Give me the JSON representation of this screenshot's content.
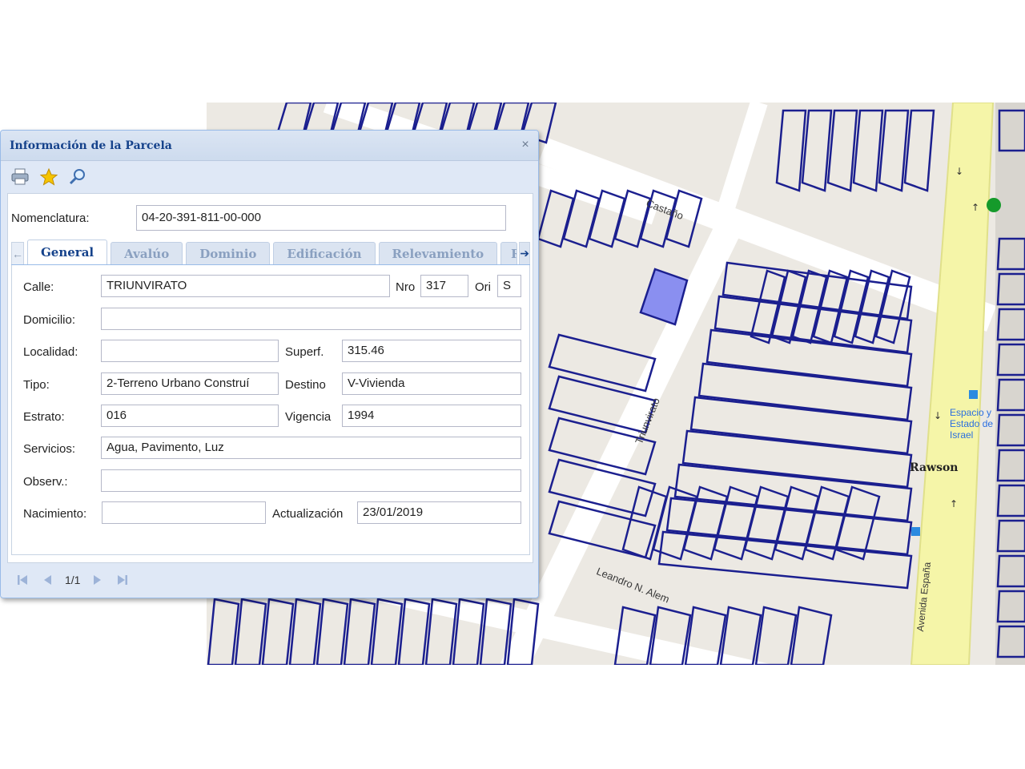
{
  "dialog": {
    "title": "Información de la Parcela",
    "close_glyph": "×",
    "toolbar": [
      {
        "icon": "printer-icon"
      },
      {
        "icon": "star-icon"
      },
      {
        "icon": "magnifier-icon"
      }
    ],
    "nomenclatura": {
      "label": "Nomenclatura:",
      "value": "04-20-391-811-00-000"
    },
    "tabs": [
      {
        "label": "General",
        "active": true
      },
      {
        "label": "Avalúo"
      },
      {
        "label": "Dominio"
      },
      {
        "label": "Edificación"
      },
      {
        "label": "Relevamiento"
      },
      {
        "label": "Ri"
      }
    ],
    "tab_prev_glyph": "←",
    "tab_next_glyph": "➔",
    "fields": {
      "calle": {
        "label": "Calle:",
        "value": "TRIUNVIRATO"
      },
      "nro": {
        "label": "Nro",
        "value": "317"
      },
      "ori": {
        "label": "Ori",
        "value": "S"
      },
      "domicilio": {
        "label": "Domicilio:",
        "value": ""
      },
      "localidad": {
        "label": "Localidad:",
        "value": ""
      },
      "superf": {
        "label": "Superf.",
        "value": "315.46"
      },
      "tipo": {
        "label": "Tipo:",
        "value": "2-Terreno Urbano Construí"
      },
      "destino": {
        "label": "Destino",
        "value": "V-Vivienda"
      },
      "estrato": {
        "label": "Estrato:",
        "value": "016"
      },
      "vigencia": {
        "label": "Vigencia",
        "value": "1994"
      },
      "servicios": {
        "label": "Servicios:",
        "value": "Agua, Pavimento, Luz"
      },
      "observ": {
        "label": "Observ.:",
        "value": ""
      },
      "nacimiento": {
        "label": "Nacimiento:",
        "value": ""
      },
      "actualizacion": {
        "label": "Actualización",
        "value": "23/01/2019"
      }
    },
    "pager": {
      "page_text": "1/1"
    }
  },
  "map": {
    "streets": {
      "castano": "Castaño",
      "triunvirato": "Triunvirato",
      "leandro": "Leandro N. Alem",
      "rawson": "Rawson",
      "avenida": "Avenida España",
      "espacio": "Espacio y Estado de Israel"
    },
    "colors": {
      "parcel_line": "#1b1f8f",
      "selected_parcel": "#8a8ff0",
      "avenue": "#f5f5a8",
      "block": "#ece9e3",
      "street": "#ffffff"
    }
  }
}
